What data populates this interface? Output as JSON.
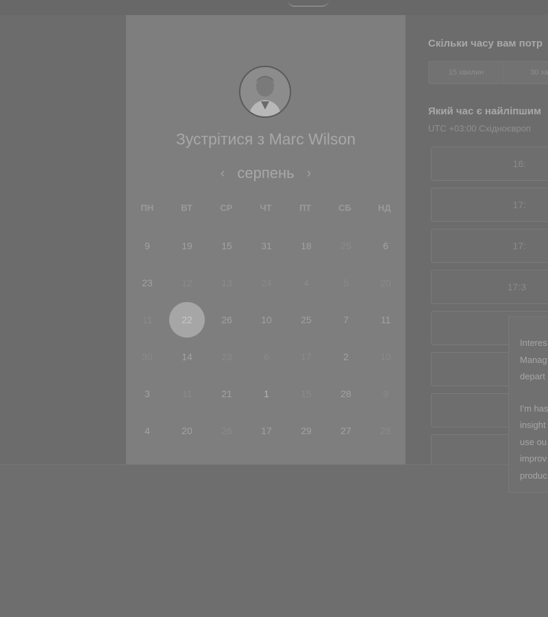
{
  "calendar": {
    "title": "Зустрітися з Marc Wilson",
    "month": "серпень",
    "prev_icon": "‹",
    "next_icon": "›",
    "weekdays": [
      "ПН",
      "ВТ",
      "СР",
      "ЧТ",
      "ПТ",
      "СБ",
      "НД"
    ],
    "days": [
      {
        "label": "9",
        "state": "normal"
      },
      {
        "label": "19",
        "state": "normal"
      },
      {
        "label": "15",
        "state": "normal"
      },
      {
        "label": "31",
        "state": "normal"
      },
      {
        "label": "18",
        "state": "normal"
      },
      {
        "label": "25",
        "state": "dim"
      },
      {
        "label": "6",
        "state": "normal"
      },
      {
        "label": "23",
        "state": "normal"
      },
      {
        "label": "12",
        "state": "dim"
      },
      {
        "label": "13",
        "state": "dim"
      },
      {
        "label": "24",
        "state": "dim"
      },
      {
        "label": "4",
        "state": "dim"
      },
      {
        "label": "5",
        "state": "dim"
      },
      {
        "label": "20",
        "state": "dim"
      },
      {
        "label": "11",
        "state": "dim"
      },
      {
        "label": "22",
        "state": "selected"
      },
      {
        "label": "26",
        "state": "normal"
      },
      {
        "label": "10",
        "state": "normal"
      },
      {
        "label": "25",
        "state": "normal"
      },
      {
        "label": "7",
        "state": "normal"
      },
      {
        "label": "11",
        "state": "normal"
      },
      {
        "label": "30",
        "state": "dim"
      },
      {
        "label": "14",
        "state": "normal"
      },
      {
        "label": "23",
        "state": "dim"
      },
      {
        "label": "6",
        "state": "dim"
      },
      {
        "label": "17",
        "state": "dim"
      },
      {
        "label": "2",
        "state": "normal"
      },
      {
        "label": "10",
        "state": "dim"
      },
      {
        "label": "3",
        "state": "normal"
      },
      {
        "label": "11",
        "state": "dim"
      },
      {
        "label": "21",
        "state": "normal"
      },
      {
        "label": "1",
        "state": "bright"
      },
      {
        "label": "15",
        "state": "dim"
      },
      {
        "label": "28",
        "state": "normal"
      },
      {
        "label": "9",
        "state": "dim"
      },
      {
        "label": "4",
        "state": "normal"
      },
      {
        "label": "20",
        "state": "normal"
      },
      {
        "label": "26",
        "state": "dim"
      },
      {
        "label": "17",
        "state": "normal"
      },
      {
        "label": "29",
        "state": "normal"
      },
      {
        "label": "27",
        "state": "normal"
      },
      {
        "label": "28",
        "state": "dim"
      }
    ]
  },
  "booking": {
    "duration_question": "Скільки часу вам потр",
    "durations": [
      "15 хвилин",
      "30 хви"
    ],
    "time_question": "Який час є найліпшим",
    "timezone": "UTC +03:00 Східноєвроп",
    "slots": [
      "16:",
      "17:",
      "17:",
      "17:3",
      "",
      "",
      "",
      ""
    ]
  },
  "popup": {
    "paragraph1": [
      "Interes",
      "Manag",
      "depart"
    ],
    "paragraph2": [
      "I'm has",
      "insight",
      "use ou",
      "improv",
      "produc"
    ]
  },
  "colors": {
    "selected_day": "#a6a6a6",
    "panel": "#7e7e7e"
  }
}
